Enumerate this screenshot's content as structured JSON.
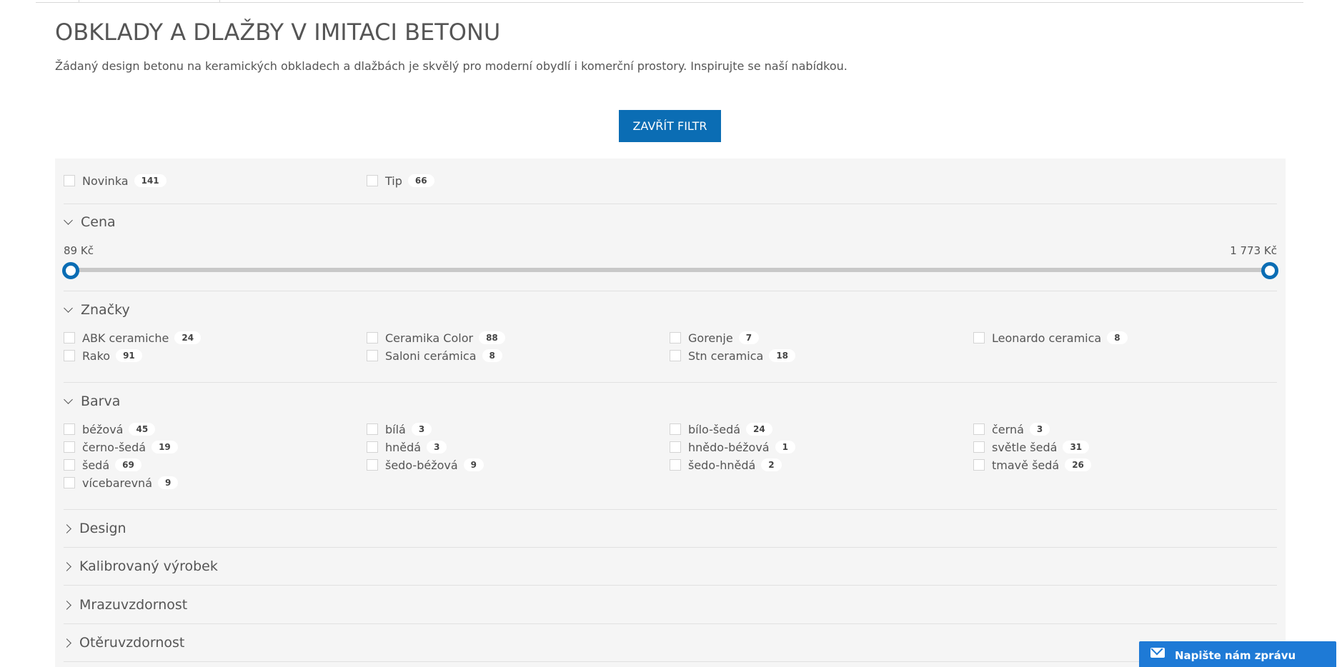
{
  "page": {
    "title": "OBKLADY A DLAŽBY V IMITACI BETONU",
    "description": "Žádaný design betonu na keramických obkladech a dlažbách je skvělý pro moderní obydlí i komerční prostory. Inspirujte se naší nabídkou."
  },
  "filter": {
    "close_label": "ZAVŘÍT FILTR",
    "flags": [
      {
        "label": "Novinka",
        "count": "141"
      },
      {
        "label": "Tip",
        "count": "66"
      }
    ],
    "price": {
      "heading": "Cena",
      "min_label": "89 Kč",
      "max_label": "1 773 Kč",
      "min_fraction": 0.0,
      "max_fraction": 1.0
    },
    "brands": {
      "heading": "Značky",
      "items": [
        {
          "label": "ABK ceramiche",
          "count": "24"
        },
        {
          "label": "Ceramika Color",
          "count": "88"
        },
        {
          "label": "Gorenje",
          "count": "7"
        },
        {
          "label": "Leonardo ceramica",
          "count": "8"
        },
        {
          "label": "Rako",
          "count": "91"
        },
        {
          "label": "Saloni cerámica",
          "count": "8"
        },
        {
          "label": "Stn ceramica",
          "count": "18"
        }
      ]
    },
    "colors": {
      "heading": "Barva",
      "items": [
        {
          "label": "béžová",
          "count": "45"
        },
        {
          "label": "bílá",
          "count": "3"
        },
        {
          "label": "bílo-šedá",
          "count": "24"
        },
        {
          "label": "černá",
          "count": "3"
        },
        {
          "label": "černo-šedá",
          "count": "19"
        },
        {
          "label": "hnědá",
          "count": "3"
        },
        {
          "label": "hnědo-béžová",
          "count": "1"
        },
        {
          "label": "světle šedá",
          "count": "31"
        },
        {
          "label": "šedá",
          "count": "69"
        },
        {
          "label": "šedo-béžová",
          "count": "9"
        },
        {
          "label": "šedo-hnědá",
          "count": "2"
        },
        {
          "label": "tmavě šedá",
          "count": "26"
        },
        {
          "label": "vícebarevná",
          "count": "9"
        }
      ]
    },
    "collapsed_sections": [
      {
        "heading": "Design"
      },
      {
        "heading": "Kalibrovaný výrobek"
      },
      {
        "heading": "Mrazuvzdornost"
      },
      {
        "heading": "Otěruvzdornost"
      }
    ]
  },
  "chat": {
    "label": "Napište nám zprávu",
    "icon": "mail-icon"
  },
  "colors": {
    "accent": "#0b6db4",
    "chat": "#1e7ad6",
    "panel_bg": "#f5f5f5"
  }
}
